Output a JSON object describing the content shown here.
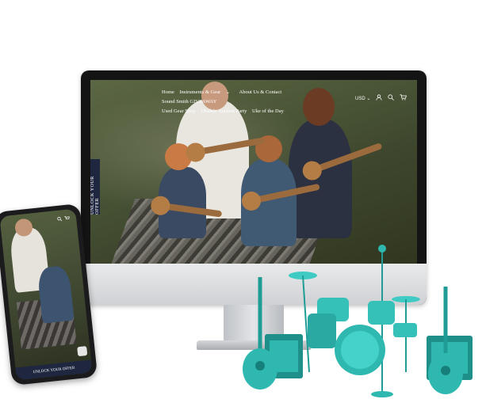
{
  "desktop": {
    "nav": {
      "items": [
        "Home",
        "Instruments & Gear",
        "About Us & Contact",
        "Sound Smith GIVEAWAY",
        "Used Gear Shop",
        "Ukulele Auction Party",
        "Uke of the Day"
      ],
      "currency": "USD",
      "icons": [
        "chevron-down-icon",
        "account-icon",
        "search-icon",
        "cart-icon"
      ]
    },
    "side_tab": "UNLOCK YOUR OFFER"
  },
  "phone": {
    "offer_bar": "UNLOCK YOUR OFFER",
    "icons": [
      "search-icon",
      "cart-icon"
    ]
  },
  "colors": {
    "accent_navy": "#1f2740",
    "instrument_teal": "#2fb8b0"
  }
}
